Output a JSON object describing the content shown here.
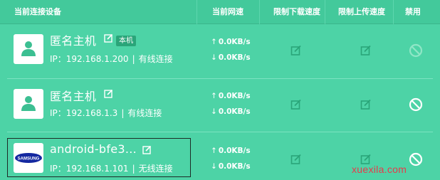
{
  "header": {
    "device_col": "当前连接设备",
    "speed_col": "当前网速",
    "down_limit_col": "限制下载速度",
    "up_limit_col": "限制上传速度",
    "ban_col": "禁用"
  },
  "devices": [
    {
      "name": "匿名主机",
      "badge": "本机",
      "ip_label": "IP：192.168.1.200",
      "sep": "|",
      "conn_type": "有线连接",
      "up_speed": "0.0KB/s",
      "down_speed": "0.0KB/s",
      "avatar_icon": "person-icon",
      "ban_state": "disabled"
    },
    {
      "name": "匿名主机",
      "ip_label": "IP：192.168.1.3",
      "sep": "|",
      "conn_type": "有线连接",
      "up_speed": "0.0KB/s",
      "down_speed": "0.0KB/s",
      "avatar_icon": "person-icon",
      "ban_state": "enabled"
    },
    {
      "name": "android-bfe3...",
      "ip_label": "IP：192.168.1.101",
      "sep": "|",
      "conn_type": "无线连接",
      "up_speed": "0.0KB/s",
      "down_speed": "0.0KB/s",
      "avatar_icon": "samsung-logo",
      "avatar_logo_text": "SAMSUNG",
      "ban_state": "enabled"
    }
  ],
  "arrows": {
    "up": "↑",
    "down": "↓"
  },
  "watermark": "xuexila.com",
  "colors": {
    "background": "#4dd3a6",
    "header": "#43c99b",
    "badge": "#2aa579",
    "icon": "#3cbf92",
    "samsung_blue": "#1428a0",
    "watermark": "#e83a4a"
  }
}
